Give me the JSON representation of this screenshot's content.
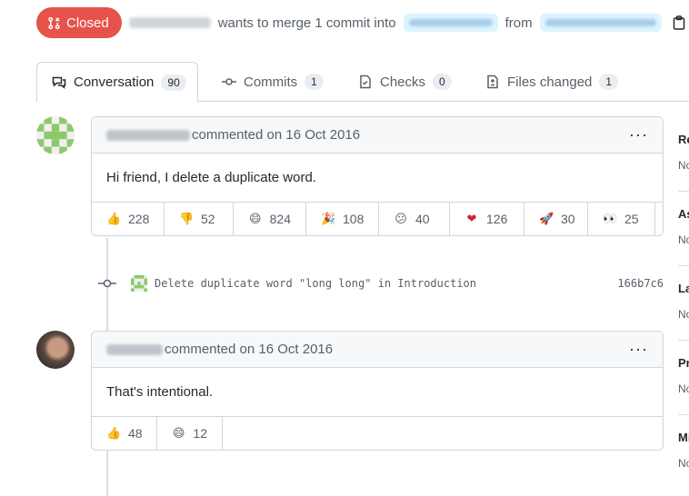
{
  "header": {
    "state": "Closed",
    "text": "wants to merge 1 commit into",
    "from_text": "from",
    "copy_icon": "clipboard-icon"
  },
  "tabs": [
    {
      "label": "Conversation",
      "count": "90",
      "icon": "comment-discussion-icon"
    },
    {
      "label": "Commits",
      "count": "1",
      "icon": "commit-icon"
    },
    {
      "label": "Checks",
      "count": "0",
      "icon": "checklist-icon"
    },
    {
      "label": "Files changed",
      "count": "1",
      "icon": "file-diff-icon"
    }
  ],
  "comments": [
    {
      "meta": "commented on 16 Oct 2016",
      "body": "Hi friend, I delete a duplicate word.",
      "reactions": [
        {
          "emoji": "👍",
          "count": "228"
        },
        {
          "emoji": "👎",
          "count": "52"
        },
        {
          "emoji": "😄",
          "count": "824"
        },
        {
          "emoji": "🎉",
          "count": "108"
        },
        {
          "emoji": "😕",
          "count": "40"
        },
        {
          "emoji": "❤",
          "count": "126"
        },
        {
          "emoji": "🚀",
          "count": "30"
        },
        {
          "emoji": "👀",
          "count": "25"
        }
      ]
    },
    {
      "meta": "commented on 16 Oct 2016",
      "body": "That's intentional.",
      "reactions": [
        {
          "emoji": "👍",
          "count": "48"
        },
        {
          "emoji": "😄",
          "count": "12"
        }
      ]
    }
  ],
  "commit": {
    "message": "Delete duplicate word \"long long\" in Introduction",
    "sha": "166b7c6"
  },
  "sidebar": [
    {
      "title": "Re",
      "value": "No"
    },
    {
      "title": "As",
      "value": "No"
    },
    {
      "title": "La",
      "value": "No"
    },
    {
      "title": "Pr",
      "value": "No"
    },
    {
      "title": "Mi",
      "value": "No"
    }
  ],
  "colors": {
    "closed": "#e5534b",
    "border": "#d0d7de",
    "header_bg": "#f6f8fa",
    "heart": "#cf222e"
  }
}
